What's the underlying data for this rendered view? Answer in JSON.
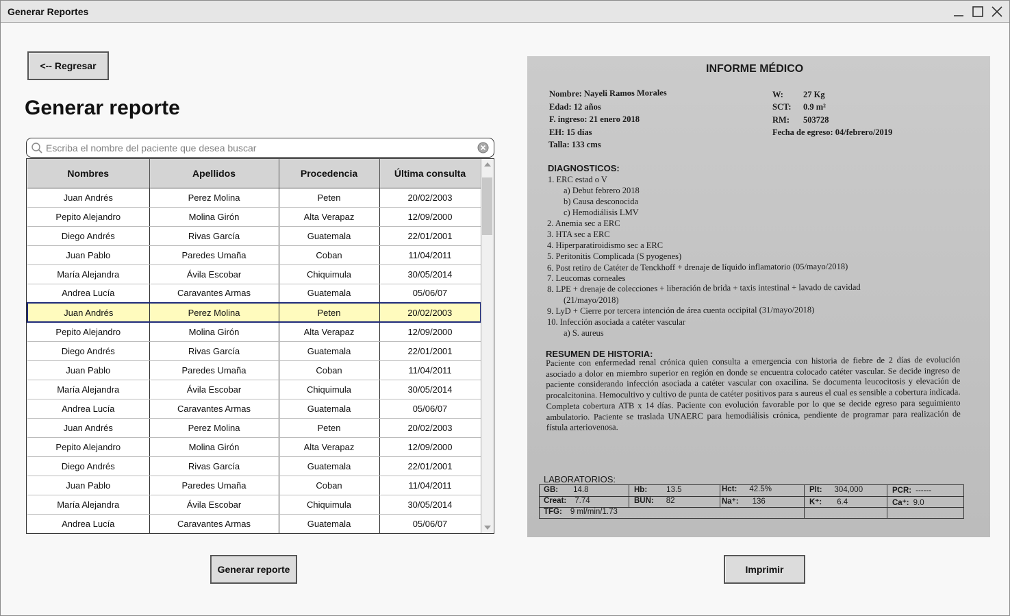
{
  "window": {
    "title": "Generar Reportes"
  },
  "back_button": "<-- Regresar",
  "page_title": "Generar reporte",
  "search": {
    "placeholder": "Escriba el nombre del paciente que desea buscar",
    "value": ""
  },
  "table": {
    "headers": [
      "Nombres",
      "Apellidos",
      "Procedencia",
      "Última consulta"
    ],
    "selected_row_index": 6,
    "rows": [
      [
        "Juan Andrés",
        "Perez Molina",
        "Peten",
        "20/02/2003"
      ],
      [
        "Pepito Alejandro",
        "Molina Girón",
        "Alta Verapaz",
        "12/09/2000"
      ],
      [
        "Diego Andrés",
        "Rivas García",
        "Guatemala",
        "22/01/2001"
      ],
      [
        "Juan Pablo",
        "Paredes Umaña",
        "Coban",
        "11/04/2011"
      ],
      [
        "María Alejandra",
        "Ávila Escobar",
        "Chiquimula",
        "30/05/2014"
      ],
      [
        "Andrea Lucía",
        "Caravantes Armas",
        "Guatemala",
        "05/06/07"
      ],
      [
        "Juan Andrés",
        "Perez Molina",
        "Peten",
        "20/02/2003"
      ],
      [
        "Pepito Alejandro",
        "Molina Girón",
        "Alta Verapaz",
        "12/09/2000"
      ],
      [
        "Diego Andrés",
        "Rivas García",
        "Guatemala",
        "22/01/2001"
      ],
      [
        "Juan Pablo",
        "Paredes Umaña",
        "Coban",
        "11/04/2011"
      ],
      [
        "María Alejandra",
        "Ávila Escobar",
        "Chiquimula",
        "30/05/2014"
      ],
      [
        "Andrea Lucía",
        "Caravantes Armas",
        "Guatemala",
        "05/06/07"
      ],
      [
        "Juan Andrés",
        "Perez Molina",
        "Peten",
        "20/02/2003"
      ],
      [
        "Pepito Alejandro",
        "Molina Girón",
        "Alta Verapaz",
        "12/09/2000"
      ],
      [
        "Diego Andrés",
        "Rivas García",
        "Guatemala",
        "22/01/2001"
      ],
      [
        "Juan Pablo",
        "Paredes Umaña",
        "Coban",
        "11/04/2011"
      ],
      [
        "María Alejandra",
        "Ávila Escobar",
        "Chiquimula",
        "30/05/2014"
      ],
      [
        "Andrea Lucía",
        "Caravantes Armas",
        "Guatemala",
        "05/06/07"
      ]
    ]
  },
  "generate_button": "Generar reporte",
  "print_button": "Imprimir",
  "report": {
    "title": "INFORME MÉDICO",
    "patient": [
      "Nombre: Nayeli Ramos Morales",
      "Edad:  12 años",
      "F. ingreso: 21 enero 2018",
      "EH:    15 días",
      "Talla:  133 cms"
    ],
    "vitals_labels": [
      "W:",
      "SCT:",
      "RM:"
    ],
    "vitals_values": [
      "27 Kg",
      "0.9 m²",
      "503728"
    ],
    "discharge": "Fecha de egreso: 04/febrero/2019",
    "diagnosticos_title": "DIAGNOSTICOS:",
    "diagnosticos": [
      "1.   ERC estad o V",
      "a)   Debut febrero 2018",
      "b)   Causa desconocida",
      "c)   Hemodiálisis LMV",
      "2.   Anemia sec a ERC",
      "3.   HTA sec a ERC",
      "4.   Hiperparatiroidismo sec a ERC",
      "5.   Peritonitis Complicada (S pyogenes)",
      "6.   Post retiro de Catéter de Tenckhoff + drenaje de líquido inflamatorio (05/mayo/2018)",
      "7.   Leucomas corneales",
      "8.   LPE  +  drenaje  de  colecciones  +  liberación  de  brida  +  taxis  intestinal  +  lavado  de  cavidad",
      "(21/mayo/2018)",
      "9.   LyD + Cierre por tercera intención de área cuenta occipital (31/mayo/2018)",
      "10.  Infección asociada a catéter vascular",
      "a)   S. aureus"
    ],
    "historia_title": "RESUMEN DE HISTORIA:",
    "historia": "Paciente con enfermedad renal crónica quien consulta a emergencia con historia de fiebre de 2 días de evolución asociado a dolor en miembro superior en región en donde se encuentra colocado catéter vascular. Se decide ingreso de paciente considerando infección asociada a catéter vascular con oxacilina. Se documenta leucocitosis y elevación de procalcitonina. Hemocultivo y cultivo de punta de catéter positivos para s aureus el cual es sensible a cobertura indicada. Completa cobertura ATB x 14 días. Paciente con evolución favorable por lo que se decide egreso para seguimiento ambulatorio. Paciente se traslada UNAERC para hemodiálisis crónica, pendiente de programar para realización de fístula arteriovenosa.",
    "lab_title": "LABORATORIOS:",
    "labs": {
      "gb_label": "GB:",
      "gb": "14.8",
      "hb_label": "Hb:",
      "hb": "13.5",
      "hct_label": "Hct:",
      "hct": "42.5%",
      "plt_label": "Plt:",
      "plt": "304,000",
      "pcr_label": "PCR:",
      "pcr": "------",
      "creat_label": "Creat:",
      "creat": "7.74",
      "bun_label": "BUN:",
      "bun": "82",
      "na_label": "Na⁺:",
      "na": "136",
      "k_label": "K⁺:",
      "k": "6.4",
      "ca_label": "Ca⁺:",
      "ca": "9.0",
      "tfg_label": "TFG:",
      "tfg": "9 ml/min/1.73"
    }
  }
}
